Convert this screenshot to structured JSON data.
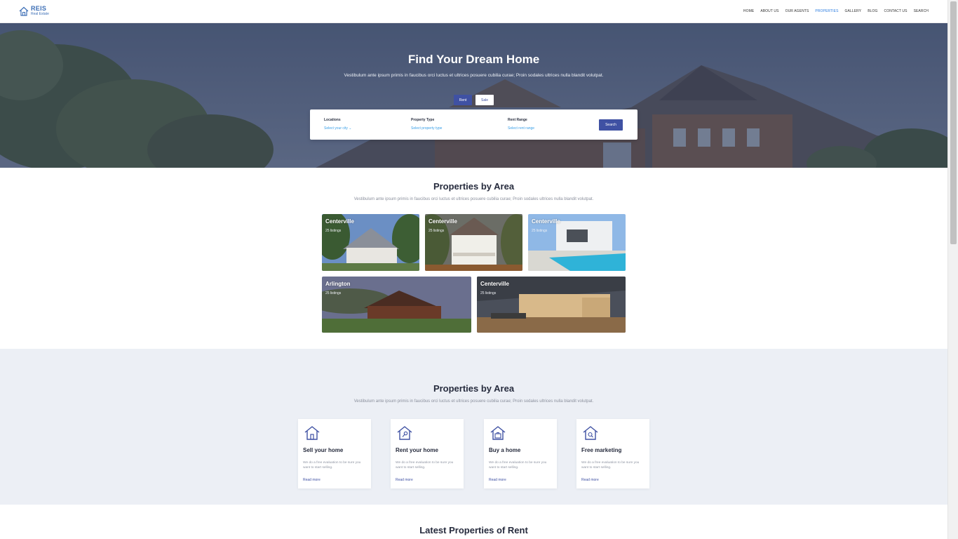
{
  "brand": {
    "name": "REIS",
    "tagline": "Real Estate"
  },
  "nav": [
    {
      "label": "HOME",
      "active": false
    },
    {
      "label": "ABOUT US",
      "active": false
    },
    {
      "label": "OUR AGENTS",
      "active": false
    },
    {
      "label": "PROPERTIES",
      "active": true
    },
    {
      "label": "GALLERY",
      "active": false
    },
    {
      "label": "BLOG",
      "active": false
    },
    {
      "label": "CONTACT US",
      "active": false
    },
    {
      "label": "SEARCH",
      "active": false
    }
  ],
  "hero": {
    "title": "Find Your Dream Home",
    "subtitle": "Vestibulum ante ipsum primis in faucibus orci luctus et ultrices posuere cubilia curae; Proin sodales ultrices nulla blandit volutpat.",
    "tabs": [
      "Rent",
      "Sale"
    ],
    "search": {
      "fields": [
        {
          "label": "Locations",
          "value": "Select your city"
        },
        {
          "label": "Property Type",
          "value": "Select property type"
        },
        {
          "label": "Rent Range",
          "value": "Select rent range"
        }
      ],
      "button": "Search"
    }
  },
  "areas": {
    "title": "Properties by Area",
    "subtitle": "Vestibulum ante ipsum primis in faucibus orci luctus et ultrices posuere cubilia curae; Proin sodales ultrices nulla blandit volutpat.",
    "cards": [
      {
        "name": "Centerville",
        "count": "25 listings"
      },
      {
        "name": "Centerville",
        "count": "25 listings"
      },
      {
        "name": "Centerville",
        "count": "25 listings"
      },
      {
        "name": "Arlington",
        "count": "25 listings"
      },
      {
        "name": "Centerville",
        "count": "25 listings"
      }
    ]
  },
  "services": {
    "title": "Properties by Area",
    "subtitle": "Vestibulum ante ipsum primis in faucibus orci luctus et ultrices posuere cubilia curae; Proin sodales ultrices nulla blandit volutpat.",
    "items": [
      {
        "title": "Sell your home",
        "desc": "We do a free evaluation to be sure you want to start selling.",
        "link": "Read more",
        "icon": "house-door-icon"
      },
      {
        "title": "Rent your home",
        "desc": "We do a free evaluation to be sure you want to start selling.",
        "link": "Read more",
        "icon": "house-key-icon"
      },
      {
        "title": "Buy a home",
        "desc": "We do a free evaluation to be sure you want to start selling.",
        "link": "Read more",
        "icon": "house-briefcase-icon"
      },
      {
        "title": "Free marketing",
        "desc": "We do a free evaluation to be sure you want to start selling.",
        "link": "Read more",
        "icon": "house-search-icon"
      }
    ]
  },
  "latest": {
    "title": "Latest Properties of Rent"
  },
  "colors": {
    "accent": "#3f51a3",
    "link": "#2d7de0",
    "sectionBg": "#eceff5"
  }
}
